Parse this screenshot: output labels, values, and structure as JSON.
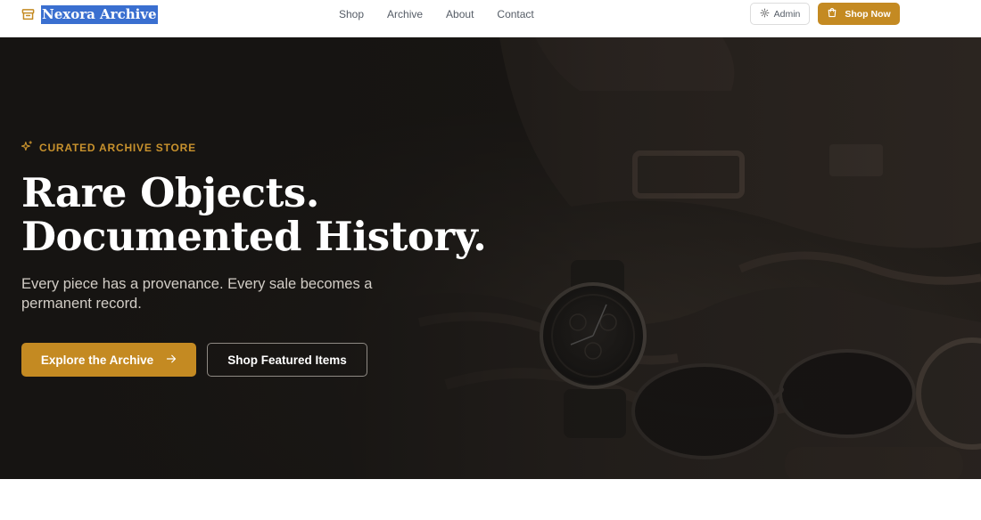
{
  "header": {
    "brand_name": "Nexora Archive",
    "brand_icon": "archive-box-icon",
    "nav": [
      {
        "label": "Shop"
      },
      {
        "label": "Archive"
      },
      {
        "label": "About"
      },
      {
        "label": "Contact"
      }
    ],
    "admin_button": {
      "label": "Admin",
      "icon": "gear-icon"
    },
    "shop_button": {
      "label": "Shop Now",
      "icon": "shopping-bag-icon"
    }
  },
  "hero": {
    "eyebrow": "CURATED ARCHIVE STORE",
    "eyebrow_icon": "sparkles-icon",
    "title_line1": "Rare Objects.",
    "title_line2": "Documented History.",
    "subtitle": "Every piece has a provenance. Every sale becomes a permanent record.",
    "primary_button": {
      "label": "Explore the Archive",
      "icon": "arrow-right-icon"
    },
    "secondary_button": {
      "label": "Shop Featured Items"
    }
  },
  "colors": {
    "accent": "#c48a22",
    "hero_background": "#1b1815",
    "brand_highlight": "#3a6fd0"
  }
}
